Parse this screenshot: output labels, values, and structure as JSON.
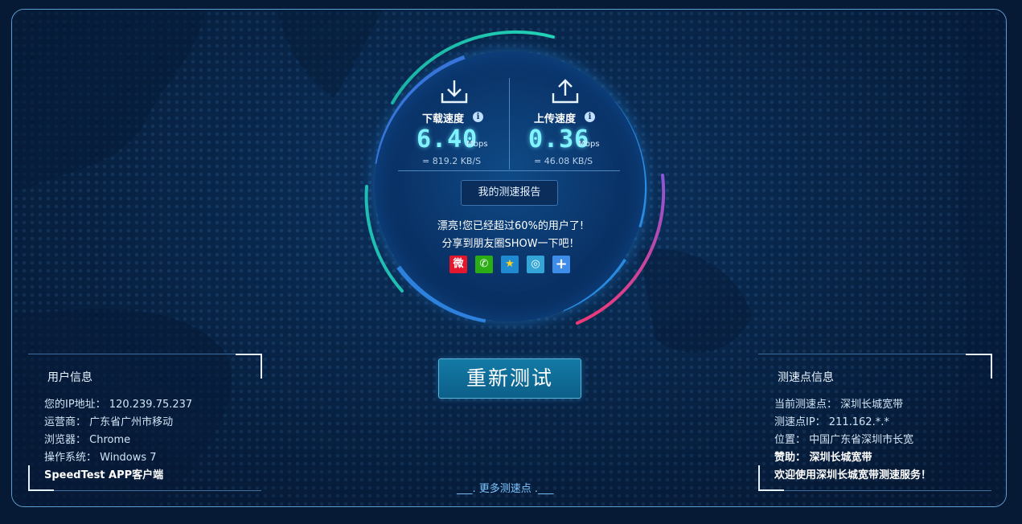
{
  "gauge": {
    "download": {
      "label": "下载速度",
      "value": "6.40",
      "unit": "Mbps",
      "kbs": "= 819.2  KB/S",
      "icon": "download-arrow-icon"
    },
    "upload": {
      "label": "上传速度",
      "value": "0.36",
      "unit": "Mbps",
      "kbs": "= 46.08  KB/S",
      "icon": "upload-arrow-icon"
    },
    "report_button": "我的测速报告",
    "congrats_line1": "漂亮!您已经超过60%的用户了!",
    "congrats_line2": "分享到朋友圈SHOW一下吧！",
    "share": [
      {
        "name": "weibo-icon",
        "color": "#e6162d"
      },
      {
        "name": "wechat-icon",
        "color": "#2bad13"
      },
      {
        "name": "qzone-icon",
        "color": "#1f8ad2"
      },
      {
        "name": "tencent-weibo-icon",
        "color": "#33a5d6"
      },
      {
        "name": "more-share-icon",
        "color": "#3e8ee9"
      }
    ]
  },
  "retest_button": "重新测试",
  "more_nodes_link": "___. 更多测速点 .___",
  "user_info": {
    "title": "用户信息",
    "ip": "您的IP地址： 120.239.75.237",
    "isp": "运营商： 广东省广州市移动",
    "browser": "浏览器： Chrome",
    "os": "操作系统： Windows 7",
    "app": "SpeedTest APP客户端"
  },
  "node_info": {
    "title": "测速点信息",
    "node": "当前测速点： 深圳长城宽带",
    "ip": "测速点IP： 211.162.*.*",
    "location": "位置： 中国广东省深圳市长宽",
    "sponsor": "赞助： 深圳长城宽带",
    "welcome": "欢迎使用深圳长城宽带测速服务！"
  },
  "colors": {
    "accent_teal": "#1fc8b0",
    "accent_blue": "#2a8be0",
    "accent_pink": "#e8397d",
    "speed_digits": "#7ff3ff"
  }
}
